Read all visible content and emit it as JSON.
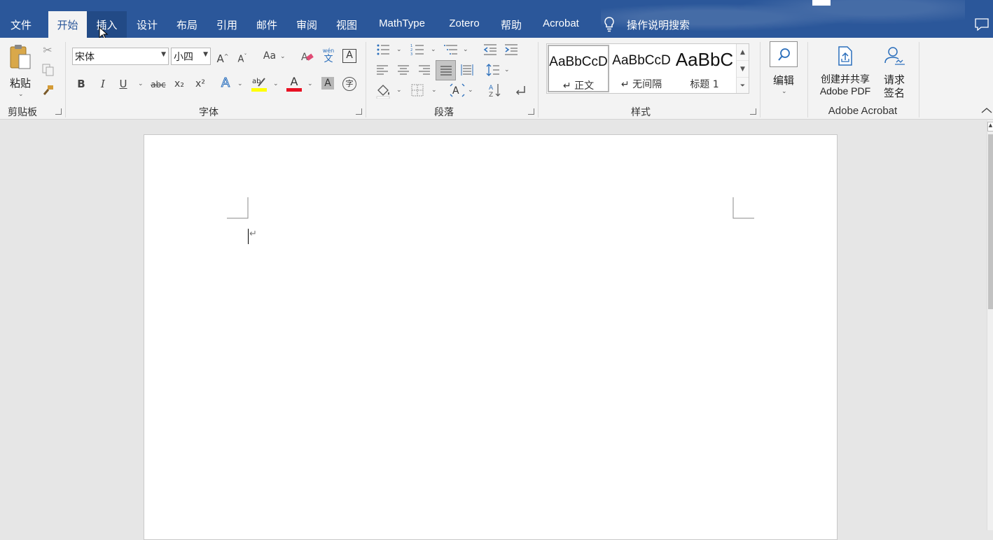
{
  "tabs": [
    {
      "label": "文件"
    },
    {
      "label": "开始"
    },
    {
      "label": "插入"
    },
    {
      "label": "设计"
    },
    {
      "label": "布局"
    },
    {
      "label": "引用"
    },
    {
      "label": "邮件"
    },
    {
      "label": "审阅"
    },
    {
      "label": "视图"
    },
    {
      "label": "MathType"
    },
    {
      "label": "Zotero"
    },
    {
      "label": "帮助"
    },
    {
      "label": "Acrobat"
    }
  ],
  "active_tab": "开始",
  "hovered_tab": "插入",
  "tell_me": {
    "label": "操作说明搜索"
  },
  "clipboard": {
    "paste_label": "粘贴",
    "group_label": "剪贴板"
  },
  "font": {
    "name": "宋体",
    "size": "小四",
    "group_label": "字体",
    "grow_glyph": "A",
    "change_case": "Aa",
    "bold": "B",
    "italic": "I",
    "underline": "U",
    "strike": "abc",
    "subscript": "x₂",
    "superscript": "x²",
    "phonetic_top": "wén",
    "phonetic_bottom": "文",
    "font_color": "A",
    "highlight_color": "#ffff00",
    "font_color_value": "#e81123"
  },
  "paragraph": {
    "group_label": "段落"
  },
  "styles": {
    "group_label": "样式",
    "items": [
      {
        "sample": "AaBbCcD",
        "name": "↵ 正文"
      },
      {
        "sample": "AaBbCcD",
        "name": "↵ 无间隔"
      },
      {
        "sample": "AaBbC",
        "name": "标题 1"
      }
    ]
  },
  "editing": {
    "label": "编辑"
  },
  "acrobat": {
    "create_label_1": "创建并共享",
    "create_label_2": "Adobe PDF",
    "sign_label_1": "请求",
    "sign_label_2": "签名",
    "group_label": "Adobe Acrobat"
  },
  "document": {
    "paragraph_mark": "↵"
  },
  "colors": {
    "titlebar": "#2b579a",
    "ribbon": "#f3f3f3",
    "page": "#ffffff",
    "workspace": "#e6e6e6"
  }
}
